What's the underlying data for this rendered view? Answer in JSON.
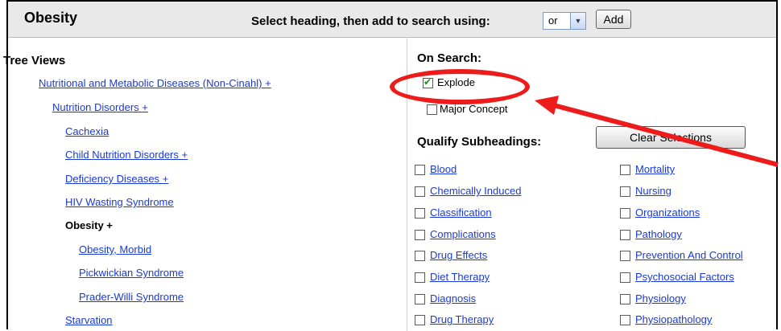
{
  "header": {
    "title": "Obesity",
    "instruction": "Select heading, then add to search using:",
    "operator_value": "or",
    "add_label": "Add"
  },
  "tree": {
    "title": "Tree Views",
    "items": [
      {
        "label": "Nutritional and Metabolic Diseases (Non-Cinahl) +"
      },
      {
        "label": "Nutrition Disorders +"
      },
      {
        "label": "Cachexia"
      },
      {
        "label": "Child Nutrition Disorders +"
      },
      {
        "label": "Deficiency Diseases +"
      },
      {
        "label": "HIV Wasting Syndrome"
      },
      {
        "label": "Obesity +"
      },
      {
        "label": "Obesity, Morbid"
      },
      {
        "label": "Pickwickian Syndrome"
      },
      {
        "label": "Prader-Willi Syndrome"
      },
      {
        "label": "Starvation"
      }
    ]
  },
  "on_search": {
    "title": "On Search:",
    "explode_label": "Explode",
    "explode_checked": true,
    "major_label": "Major Concept",
    "major_checked": false
  },
  "subheadings": {
    "title": "Qualify Subheadings:",
    "clear_label": "Clear Selections",
    "left": [
      "Blood",
      "Chemically Induced",
      "Classification",
      "Complications",
      "Drug Effects",
      "Diet Therapy",
      "Diagnosis",
      "Drug Therapy"
    ],
    "right": [
      "Mortality",
      "Nursing",
      "Organizations",
      "Pathology",
      "Prevention And Control",
      "Psychosocial Factors",
      "Physiology",
      "Physiopathology"
    ]
  },
  "annotation": {
    "highlight_color": "#ee1b1b"
  }
}
